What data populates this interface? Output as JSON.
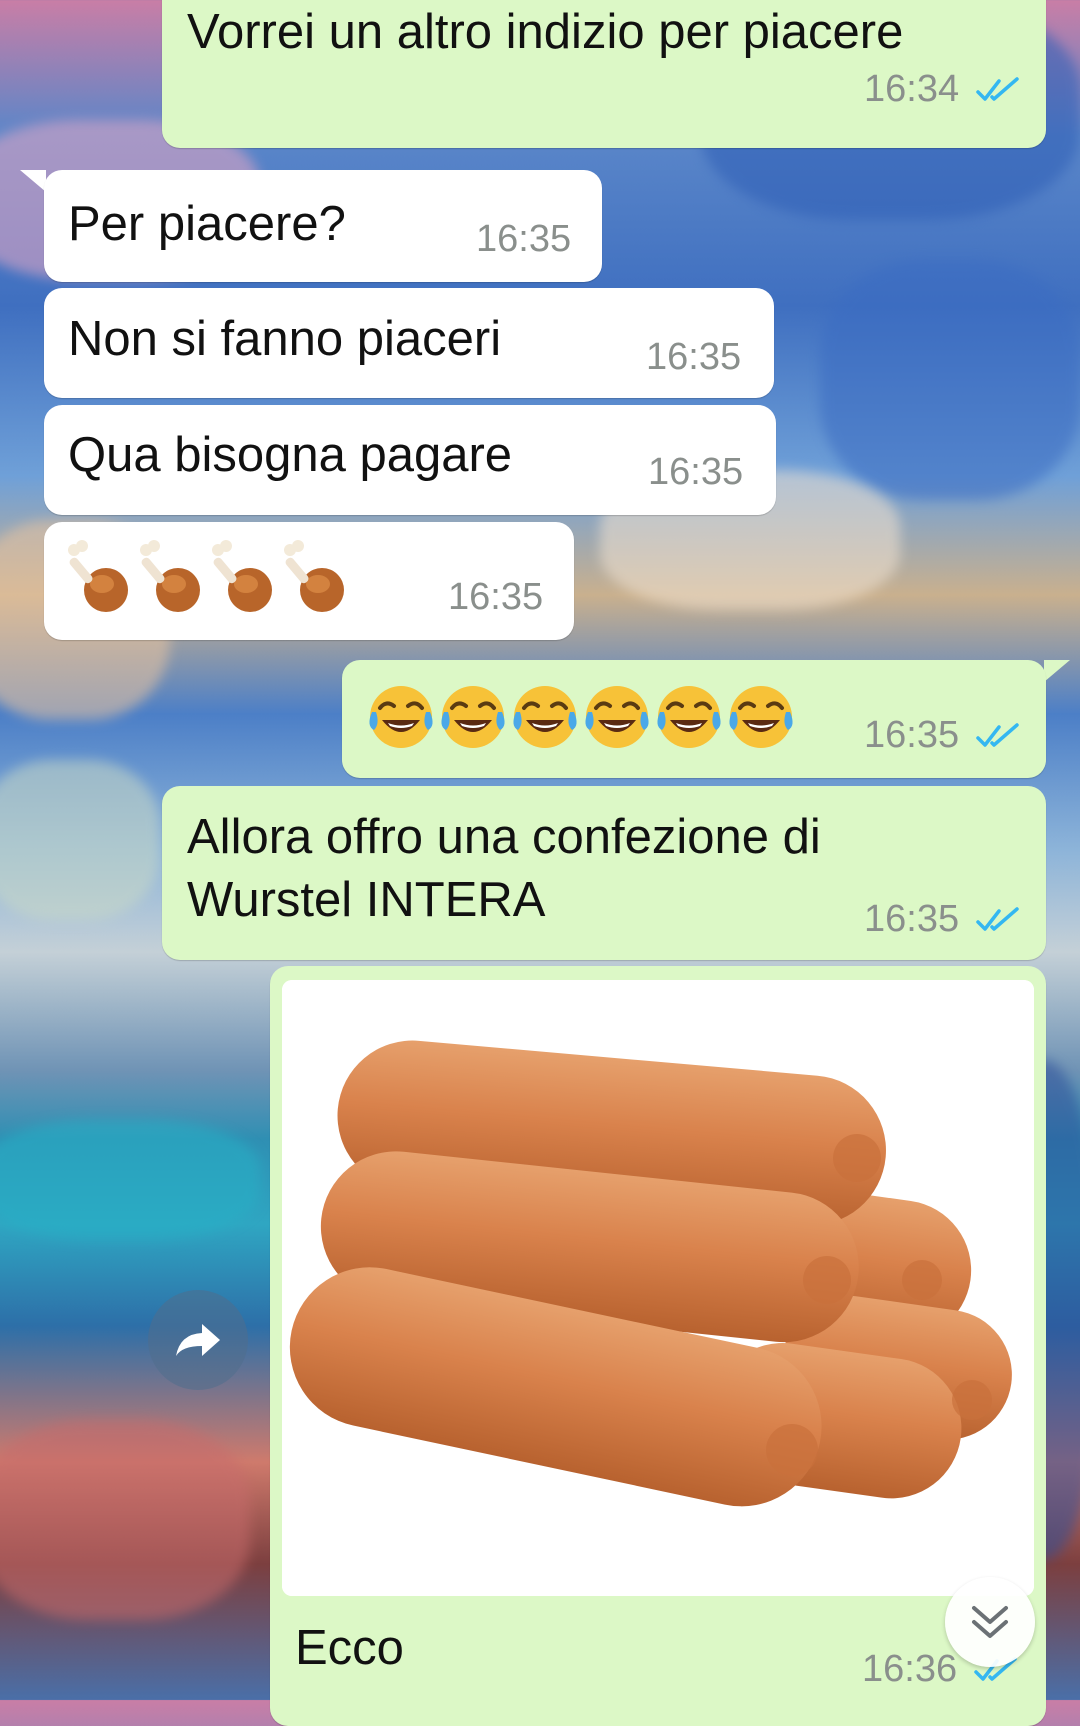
{
  "colors": {
    "outgoing_bubble": "#dcf8c6",
    "incoming_bubble": "#ffffff",
    "timestamp": "#8a8f8c",
    "read_ticks": "#34b7f1"
  },
  "messages": [
    {
      "direction": "out",
      "text": "Vorrei un altro indizio per piacere",
      "time": "16:34",
      "status": "read"
    },
    {
      "direction": "in",
      "text": "Per piacere?",
      "time": "16:35"
    },
    {
      "direction": "in",
      "text": "Non si fanno piaceri",
      "time": "16:35"
    },
    {
      "direction": "in",
      "text": "Qua bisogna pagare",
      "time": "16:35"
    },
    {
      "direction": "in",
      "emoji": "poultry-leg",
      "emoji_count": 4,
      "time": "16:35"
    },
    {
      "direction": "out",
      "emoji": "face-with-tears-of-joy",
      "emoji_count": 6,
      "time": "16:35",
      "status": "read"
    },
    {
      "direction": "out",
      "text_line1": "Allora offro una confezione di",
      "text_line2": "Wurstel INTERA",
      "time": "16:35",
      "status": "read"
    },
    {
      "direction": "out",
      "image": "sausages-photo",
      "caption": "Ecco",
      "time": "16:36",
      "status": "read"
    }
  ],
  "icons": {
    "forward": "forward-arrow-icon",
    "scroll_down": "double-chevron-down-icon",
    "read_receipt": "double-check-icon"
  }
}
